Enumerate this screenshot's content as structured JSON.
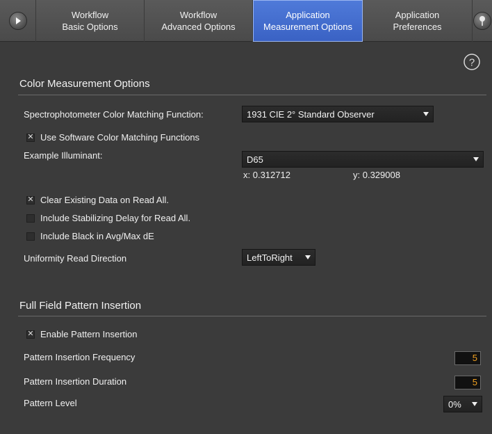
{
  "tabs": [
    {
      "line1": "Workflow",
      "line2": "Basic Options"
    },
    {
      "line1": "Workflow",
      "line2": "Advanced Options"
    },
    {
      "line1": "Application",
      "line2": "Measurement Options"
    },
    {
      "line1": "Application",
      "line2": "Preferences"
    }
  ],
  "active_tab_index": 2,
  "colors": {
    "active_tab": "#3f68c8",
    "field_value": "#f0a020",
    "background": "#3b3b3b"
  },
  "color_section": {
    "title": "Color Measurement Options",
    "cmf_label": "Spectrophotometer Color Matching Function:",
    "cmf_value": "1931 CIE 2° Standard Observer",
    "use_software_cmf_label": "Use Software Color Matching Functions",
    "use_software_cmf_checked": true,
    "illuminant_label": "Example Illuminant:",
    "illuminant_value": "D65",
    "illuminant_x": "x: 0.312712",
    "illuminant_y": "y: 0.329008",
    "clear_data_label": "Clear Existing Data on Read All.",
    "clear_data_checked": true,
    "stabilizing_label": "Include Stabilizing Delay for Read All.",
    "stabilizing_checked": false,
    "black_label": "Include Black in Avg/Max dE",
    "black_checked": false,
    "uniformity_label": "Uniformity Read Direction",
    "uniformity_value": "LeftToRight"
  },
  "pattern_section": {
    "title": "Full Field Pattern Insertion",
    "enable_label": "Enable Pattern Insertion",
    "enable_checked": true,
    "frequency_label": "Pattern Insertion Frequency",
    "frequency_value": "5",
    "duration_label": "Pattern Insertion Duration",
    "duration_value": "5",
    "level_label": "Pattern Level",
    "level_value": "0%"
  },
  "icons": {
    "left": "play-arrow-icon",
    "right": "pin-icon",
    "help": "help-icon",
    "check": "check-mark-icon"
  }
}
